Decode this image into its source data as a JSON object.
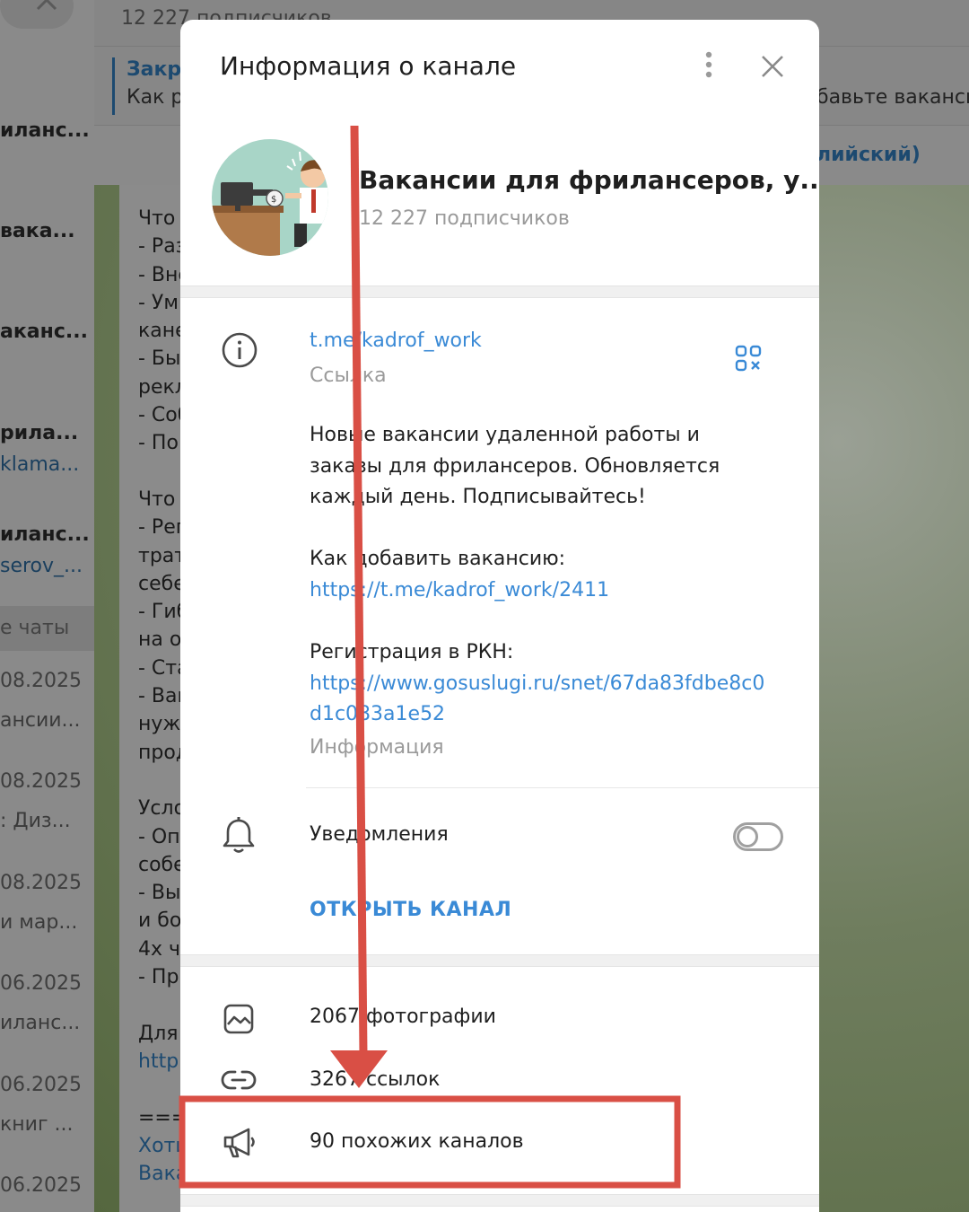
{
  "background": {
    "chat_header_subscribers": "12 227 подписчиков",
    "pinned": {
      "title": "Закре",
      "text": "Как р",
      "right_text": "бавьте ваканси"
    },
    "language_link": "лийский)",
    "sidebar": {
      "chats": [
        {
          "name": "иланс..."
        },
        {
          "name": "вака..."
        },
        {
          "name": "аканс..."
        },
        {
          "name": "рила...",
          "sub": "klama..."
        },
        {
          "name": "иланс...",
          "sub": "serov_..."
        }
      ],
      "group_label": "е чаты",
      "entries": [
        {
          "date": "08.2025",
          "sub": "ансии..."
        },
        {
          "date": "08.2025",
          "sub": ": Диз..."
        },
        {
          "date": "08.2025",
          "sub": "и мар..."
        },
        {
          "date": "06.2025",
          "sub": "иланс..."
        },
        {
          "date": "06.2025",
          "sub": "книг ..."
        },
        {
          "date": "06.2025",
          "sub": ""
        }
      ]
    },
    "message_lines": [
      "Что",
      "- Раз",
      "- Вне",
      "- Ум",
      "кане",
      "- Бы",
      "рекл",
      "- Соб",
      "- По",
      "",
      "Что",
      "- Рег",
      "трат",
      "себе",
      "- Гиб",
      "на о",
      "- Ста",
      "- Ваш",
      "нужн",
      "прод",
      "",
      "Усло",
      "- Оп",
      "собе",
      "- Вы",
      "и бо",
      "4х ч",
      "- Пр",
      "",
      "Для",
      "http",
      "",
      "====",
      "Хоти",
      "Вака"
    ]
  },
  "modal": {
    "title": "Информация о канале",
    "channel_name": "Вакансии для фрилансеров, у...",
    "subscribers": "12 227 подписчиков",
    "link_value": "t.me/kadrof_work",
    "link_label": "Ссылка",
    "description": {
      "intro": [
        "Новые вакансии удаленной работы и",
        "заказы для фрилансеров. Обновляется",
        "каждый день. Подписывайтесь!"
      ],
      "how_to_add": "Как добавить вакансию:",
      "how_to_add_link": "https://t.me/kadrof_work/2411",
      "rkn": "Регистрация в РКН:",
      "rkn_link_1": "https://www.gosuslugi.ru/snet/67da83fdbe8c0",
      "rkn_link_2": "d1c083a1e52"
    },
    "info_label": "Информация",
    "notifications_label": "Уведомления",
    "notifications_on": false,
    "open_channel": "ОТКРЫТЬ КАНАЛ",
    "media": {
      "photos": "2067 фотографии",
      "links": "3267 ссылок",
      "similar": "90 похожих каналов"
    }
  },
  "colors": {
    "accent": "#3a8ad6",
    "annotation": "#d94f45",
    "avatar_bg": "#a8d5c7"
  }
}
